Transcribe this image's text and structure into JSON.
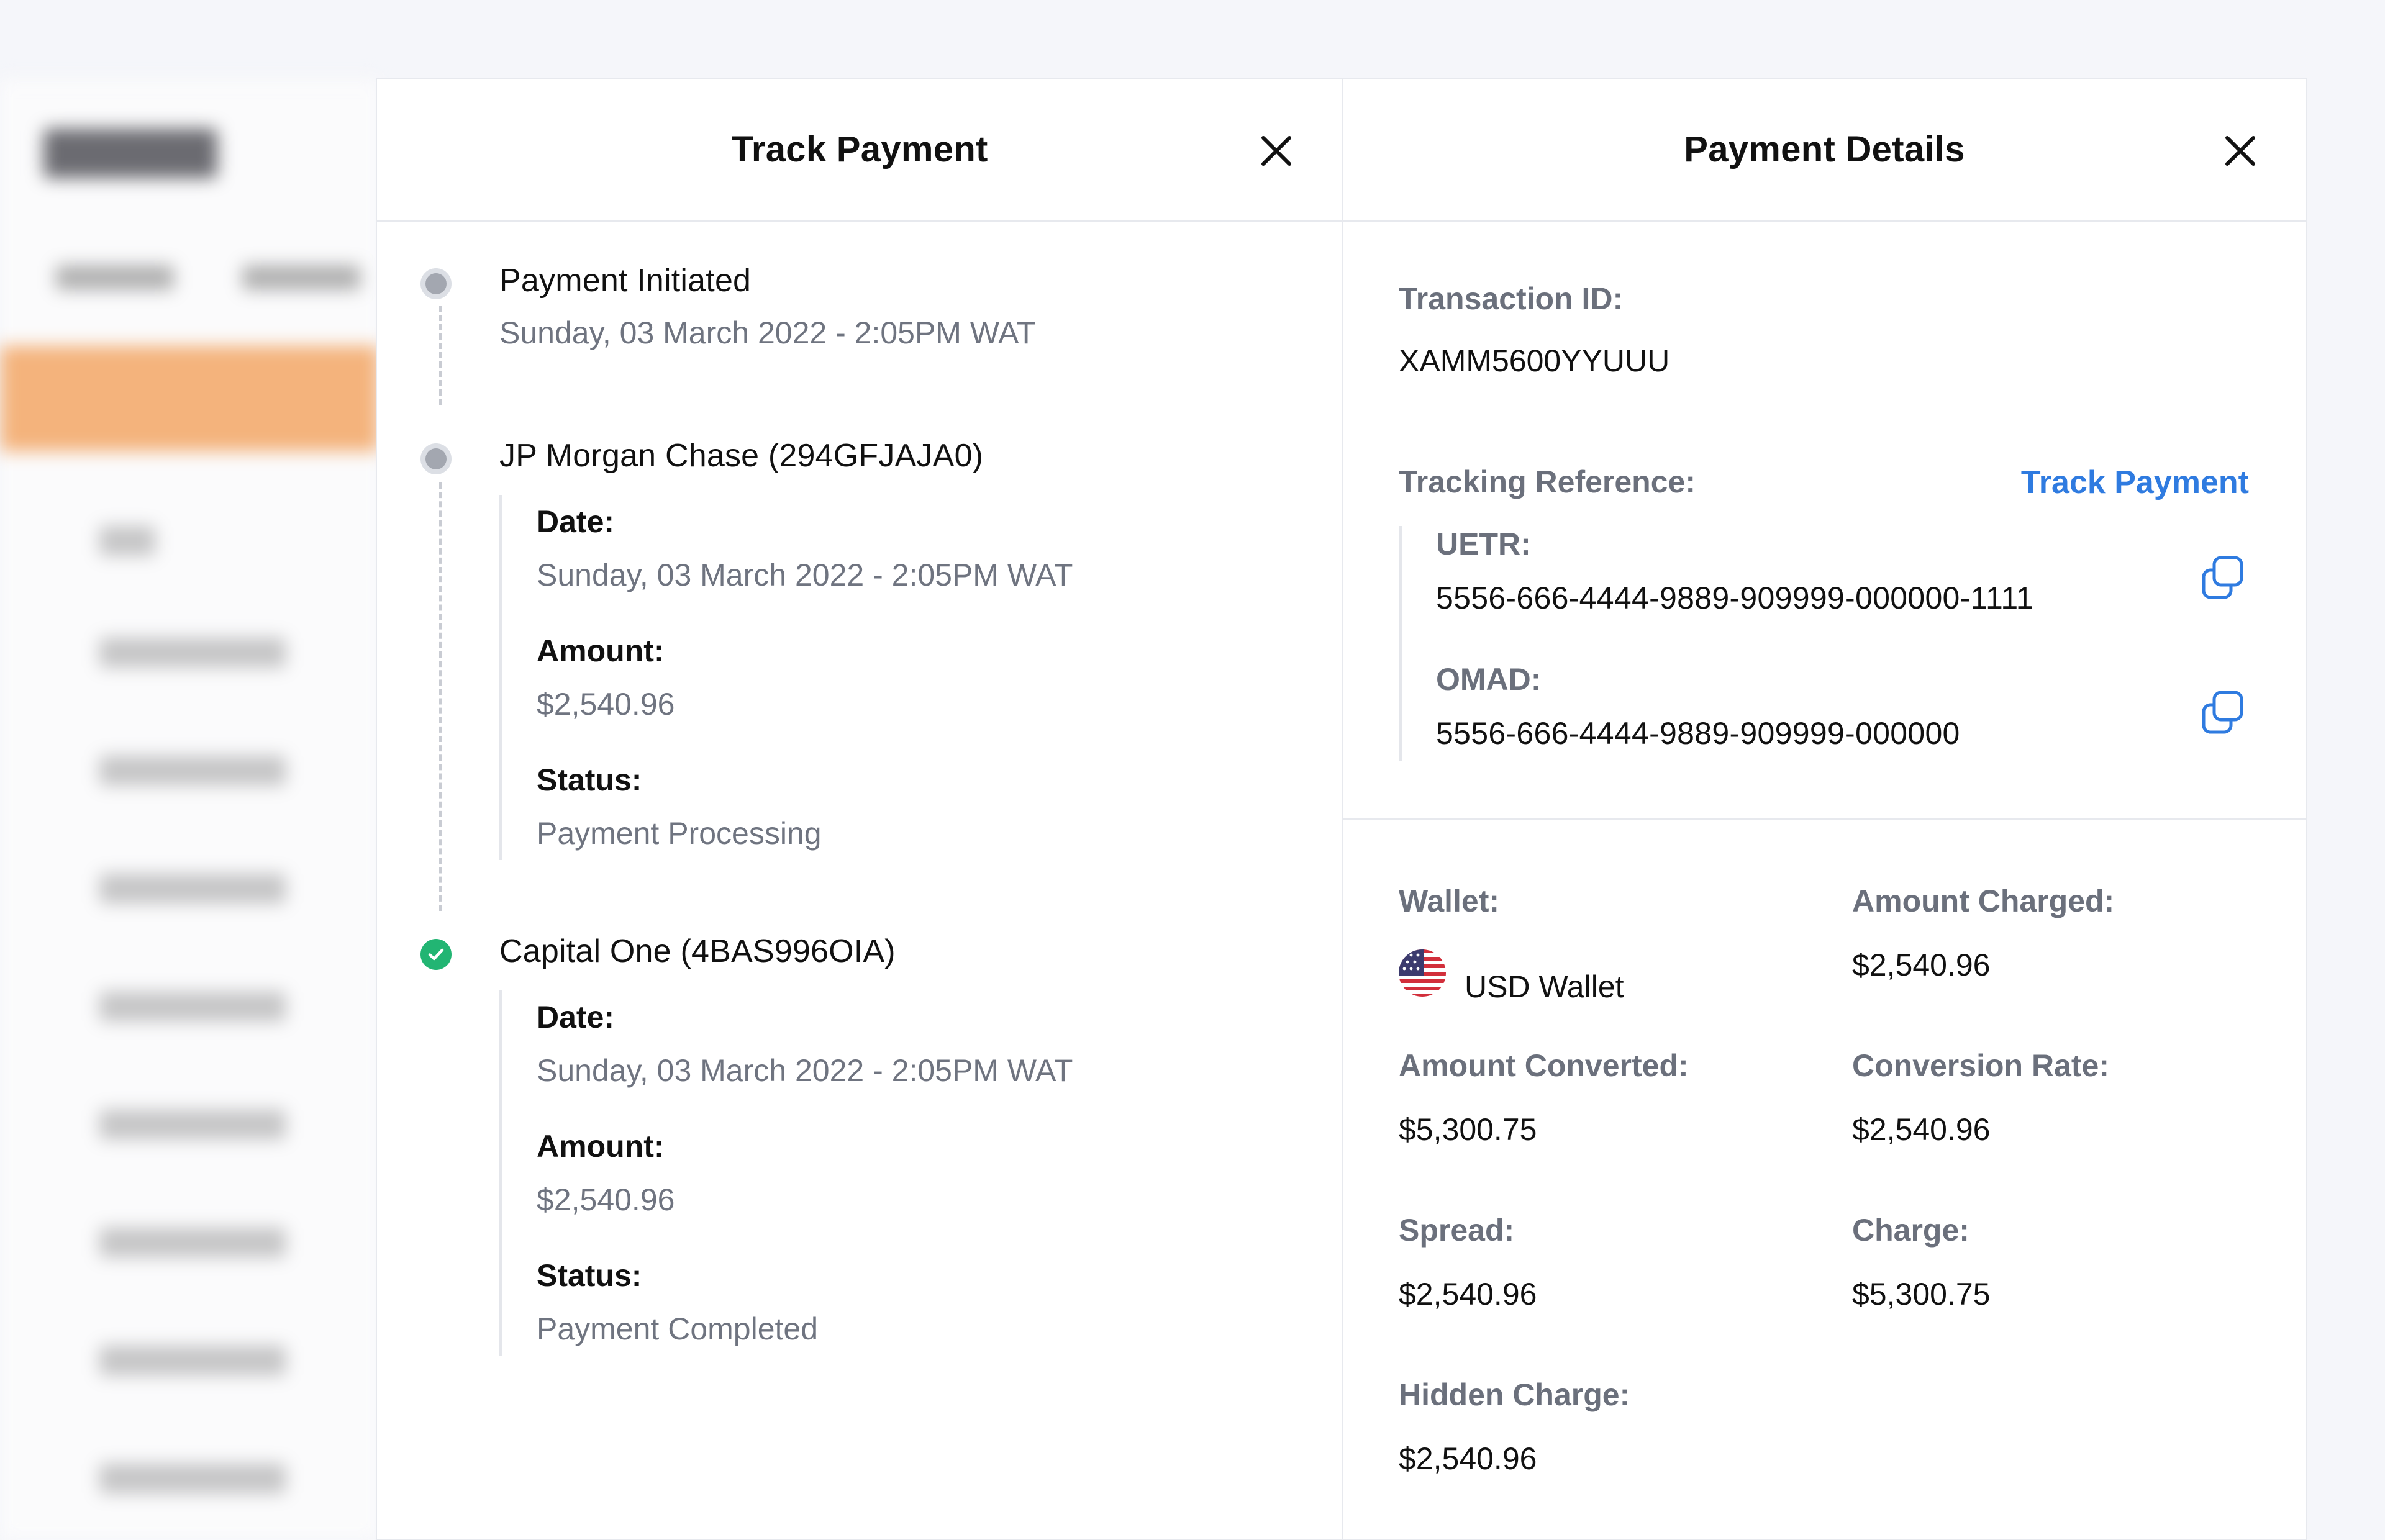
{
  "colors": {
    "accent_link": "#2f7be0",
    "step_pending": "#a3a7b0",
    "step_completed": "#22b573",
    "sidebar_active": "#f2a15b"
  },
  "track_panel": {
    "title": "Track Payment",
    "close_icon": "close-icon",
    "steps": [
      {
        "title": "Payment Initiated",
        "subtitle": "Sunday, 03 March 2022 - 2:05PM WAT",
        "state": "pending"
      },
      {
        "title": "JP Morgan Chase (294GFJAJA0)",
        "date_label": "Date:",
        "date": "Sunday, 03 March 2022 - 2:05PM WAT",
        "amount_label": "Amount:",
        "amount": "$2,540.96",
        "status_label": "Status:",
        "status": "Payment Processing",
        "state": "pending"
      },
      {
        "title": "Capital One (4BAS996OIA)",
        "date_label": "Date:",
        "date": "Sunday, 03 March 2022 - 2:05PM WAT",
        "amount_label": "Amount:",
        "amount": "$2,540.96",
        "status_label": "Status:",
        "status": "Payment Completed",
        "state": "completed"
      }
    ]
  },
  "details_panel": {
    "title": "Payment Details",
    "close_icon": "close-icon",
    "transaction_id_label": "Transaction ID:",
    "transaction_id": "XAMM5600YYUUU",
    "tracking_reference_label": "Tracking Reference:",
    "track_payment_link": "Track Payment",
    "uetr_label": "UETR:",
    "uetr": "5556-666-4444-9889-909999-000000-1111",
    "omad_label": "OMAD:",
    "omad": "5556-666-4444-9889-909999-000000",
    "copy_icon": "copy-icon",
    "wallet_label": "Wallet:",
    "wallet": "USD Wallet",
    "wallet_flag_icon": "us-flag-icon",
    "amount_charged_label": "Amount Charged:",
    "amount_charged": "$2,540.96",
    "amount_converted_label": "Amount Converted:",
    "amount_converted": "$5,300.75",
    "conversion_rate_label": "Conversion Rate:",
    "conversion_rate": "$2,540.96",
    "spread_label": "Spread:",
    "spread": "$2,540.96",
    "charge_label": "Charge:",
    "charge": "$5,300.75",
    "hidden_charge_label": "Hidden Charge:",
    "hidden_charge": "$2,540.96"
  }
}
